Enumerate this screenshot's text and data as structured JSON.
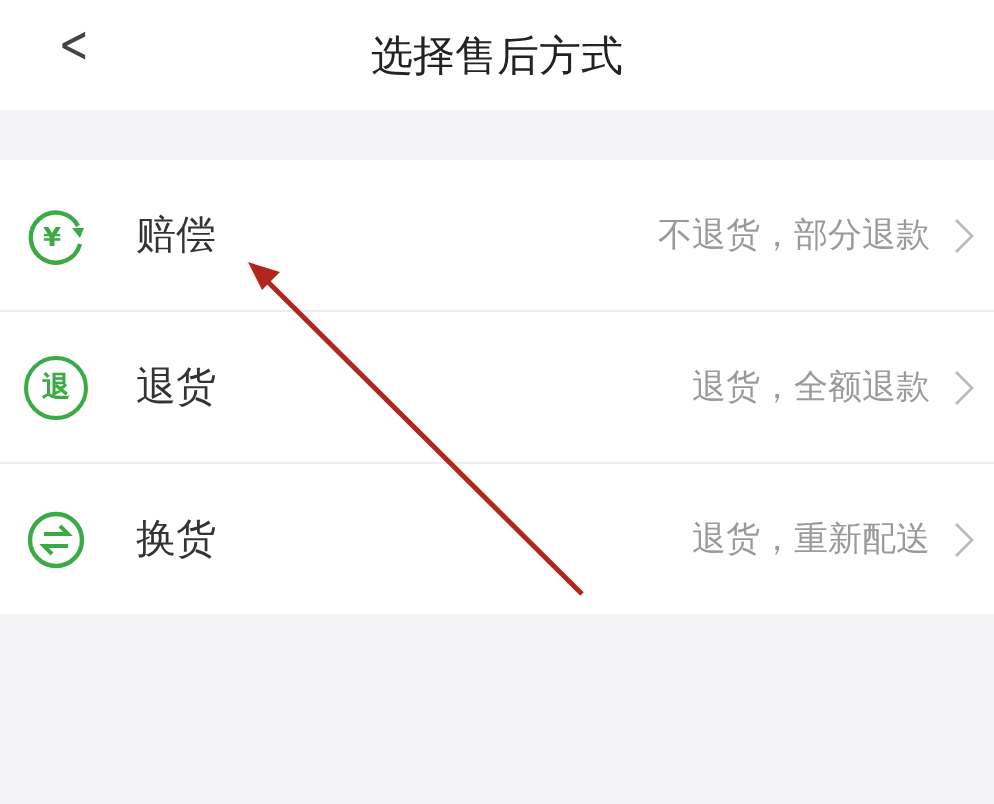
{
  "header": {
    "back": "<",
    "title": "选择售后方式"
  },
  "options": [
    {
      "kind": "compensate",
      "icon_text": "¥",
      "label": "赔偿",
      "description": "不退货，部分退款"
    },
    {
      "kind": "return",
      "icon_text": "退",
      "label": "退货",
      "description": "退货，全额退款"
    },
    {
      "kind": "exchange",
      "label": "换货",
      "description": "退货，重新配送"
    }
  ]
}
